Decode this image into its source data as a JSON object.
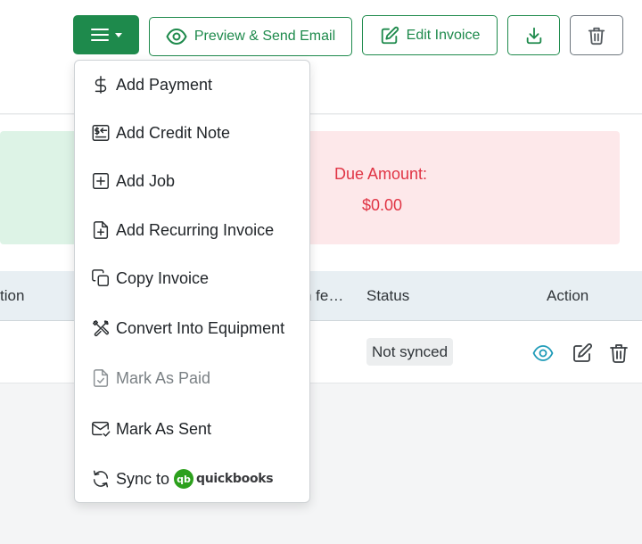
{
  "toolbar": {
    "preview_send_label": "Preview & Send Email",
    "edit_invoice_label": "Edit Invoice"
  },
  "summary": {
    "due_amount_label": "Due Amount:",
    "due_amount_value": "$0.00"
  },
  "table": {
    "headers": {
      "col1_partial": "tion",
      "col2_partial": "n fe…",
      "status": "Status",
      "action": "Action"
    },
    "row": {
      "status": "Not synced"
    }
  },
  "dropdown": {
    "items": [
      {
        "label": "Add Payment",
        "icon": "dollar-icon"
      },
      {
        "label": "Add Credit Note",
        "icon": "credit-note-icon"
      },
      {
        "label": "Add Job",
        "icon": "plus-square-icon"
      },
      {
        "label": "Add Recurring Invoice",
        "icon": "file-plus-icon"
      },
      {
        "label": "Copy Invoice",
        "icon": "copy-icon"
      },
      {
        "label": "Convert Into Equipment",
        "icon": "tools-icon"
      },
      {
        "label": "Mark As Paid",
        "icon": "file-check-icon",
        "disabled": true
      },
      {
        "label": "Mark As Sent",
        "icon": "mail-check-icon"
      },
      {
        "label": "Sync to",
        "icon": "sync-icon",
        "logo_text": "quickbooks",
        "logo_mark": "qb"
      }
    ]
  },
  "colors": {
    "brand_green": "#1e8a4c",
    "danger_red": "#e03545",
    "view_icon": "#1f9bb8"
  }
}
